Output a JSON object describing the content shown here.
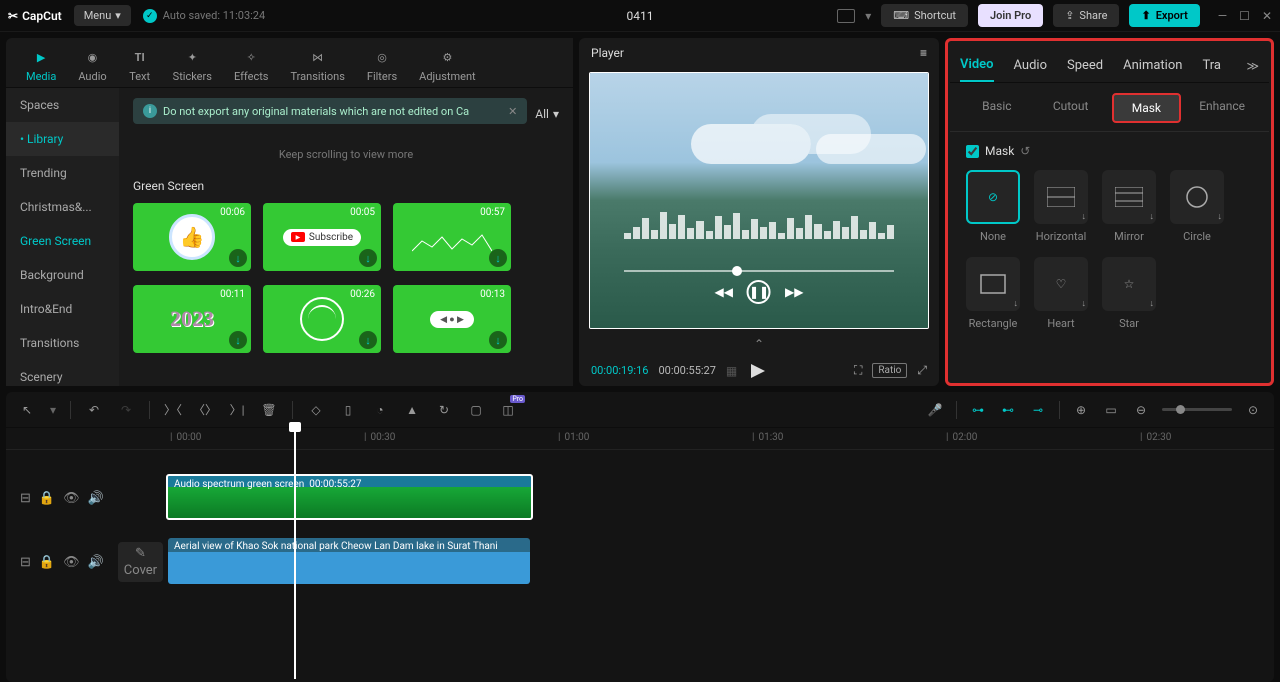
{
  "app": {
    "name": "CapCut",
    "menu": "Menu",
    "auto_save": "Auto saved: 11:03:24",
    "project": "0411"
  },
  "topbar": {
    "shortcut": "Shortcut",
    "join_pro": "Join Pro",
    "share": "Share",
    "export": "Export"
  },
  "media_tabs": [
    "Media",
    "Audio",
    "Text",
    "Stickers",
    "Effects",
    "Transitions",
    "Filters",
    "Adjustment"
  ],
  "media_tabs_active": 0,
  "sidebar_items": [
    "Spaces",
    "Library",
    "Trending",
    "Christmas&...",
    "Green Screen",
    "Background",
    "Intro&End",
    "Transitions",
    "Scenery"
  ],
  "sidebar_active": 4,
  "sidebar_sub_active": 1,
  "alert": "Do not export any original materials which are not edited on Ca",
  "alert_all": "All",
  "keep_scroll": "Keep scrolling to view more",
  "section": "Green Screen",
  "thumbs_row1": [
    "00:06",
    "00:05",
    "00:57"
  ],
  "thumbs_row2": [
    "00:11",
    "00:26",
    "00:13"
  ],
  "thumb2_text": "2023",
  "subscribe": "Subscribe",
  "player": {
    "title": "Player",
    "current": "00:00:19:16",
    "duration": "00:00:55:27",
    "ratio": "Ratio"
  },
  "inspector_tabs": [
    "Video",
    "Audio",
    "Speed",
    "Animation",
    "Tra"
  ],
  "inspector_active": 0,
  "sub_tabs": [
    "Basic",
    "Cutout",
    "Mask",
    "Enhance"
  ],
  "sub_active": 2,
  "mask": {
    "label": "Mask",
    "items": [
      "None",
      "Horizontal",
      "Mirror",
      "Circle",
      "Rectangle",
      "Heart",
      "Star"
    ],
    "selected": 0
  },
  "ruler": [
    "00:00",
    "00:30",
    "01:00",
    "01:30",
    "02:00",
    "02:30"
  ],
  "cover": "Cover",
  "clip1": {
    "name": "Audio spectrum green screen",
    "dur": "00:00:55:27"
  },
  "clip2": {
    "name": "Aerial view of Khao Sok national park Cheow Lan Dam lake in Surat Thani"
  }
}
